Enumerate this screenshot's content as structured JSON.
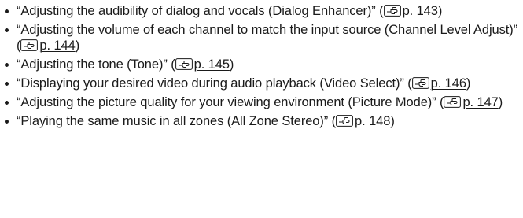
{
  "items": [
    {
      "text": "“Adjusting the audibility of dialog and vocals (Dialog Enhancer)” (",
      "page": "p. 143",
      "close": ")"
    },
    {
      "text": "“Adjusting the volume of each channel to match the input source (Channel Level Adjust)” (",
      "page": "p. 144",
      "close": ")"
    },
    {
      "text": "“Adjusting the tone (Tone)” (",
      "page": "p. 145",
      "close": ")"
    },
    {
      "text": "“Displaying your desired video during audio playback (Video Select)” (",
      "page": "p. 146",
      "close": ")"
    },
    {
      "text": "“Adjusting the picture quality for your viewing environment (Picture Mode)” (",
      "page": "p. 147",
      "close": ")"
    },
    {
      "text": "“Playing the same music in all zones (All Zone Stereo)” (",
      "page": "p. 148",
      "close": ")"
    }
  ],
  "icon": "pointing-hand-reference-icon"
}
